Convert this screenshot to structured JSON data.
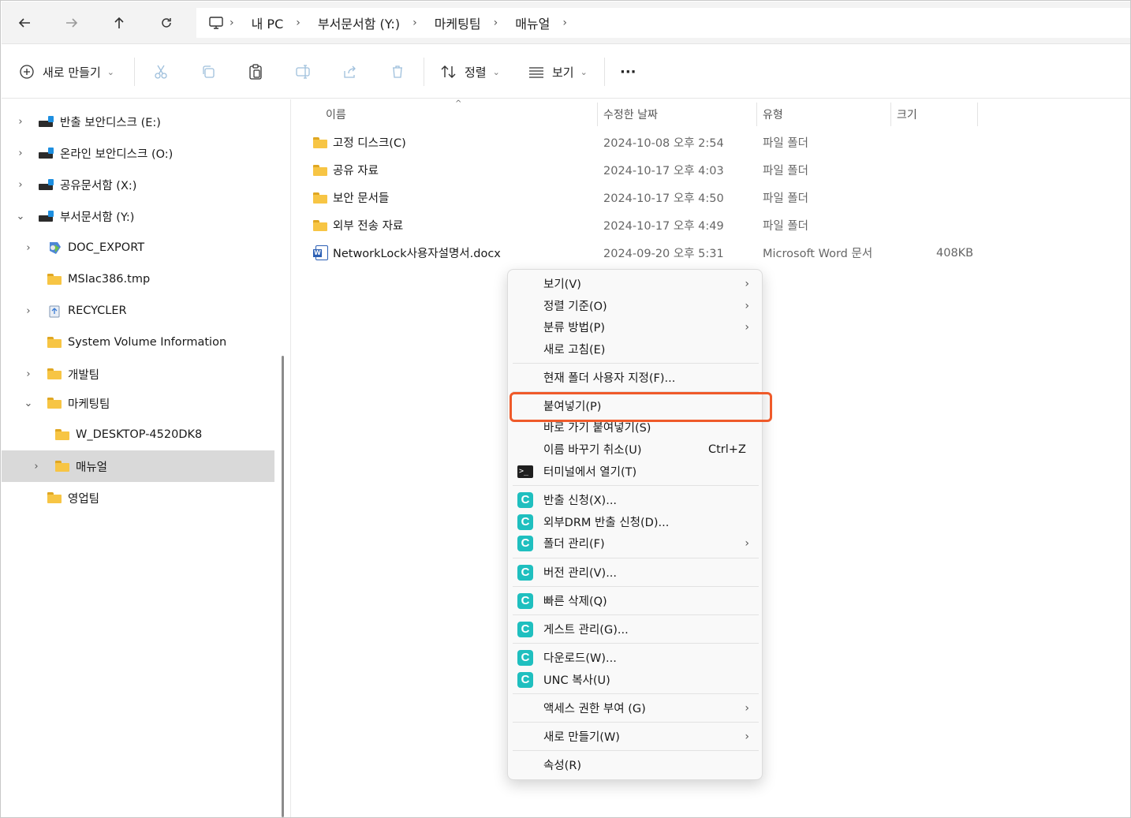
{
  "address_bar": {
    "back_icon": "arrow-left-icon",
    "forward_icon": "arrow-right-icon",
    "up_icon": "arrow-up-icon",
    "refresh_icon": "refresh-icon",
    "computer_icon": "monitor-icon",
    "breadcrumbs": [
      "내 PC",
      "부서문서함 (Y:)",
      "마케팅팀",
      "매뉴얼"
    ],
    "separator": "›"
  },
  "toolbar": {
    "new_label": "새로 만들기",
    "sort_label": "정렬",
    "view_label": "보기",
    "more_label": "···",
    "caret": "⌄"
  },
  "nav": {
    "items": [
      {
        "label": "반출 보안디스크 (E:)",
        "chevron": "›",
        "icon": "drive"
      },
      {
        "label": "온라인 보안디스크 (O:)",
        "chevron": "›",
        "icon": "drive"
      },
      {
        "label": "공유문서함 (X:)",
        "chevron": "›",
        "icon": "drive"
      },
      {
        "label": "부서문서함 (Y:)",
        "chevron": "⌄",
        "icon": "drive"
      },
      {
        "label": "DOC_EXPORT",
        "chevron": "›",
        "icon": "network-folder"
      },
      {
        "label": "MSIac386.tmp",
        "chevron": "",
        "icon": "folder"
      },
      {
        "label": "RECYCLER",
        "chevron": "›",
        "icon": "recycle"
      },
      {
        "label": "System Volume Information",
        "chevron": "",
        "icon": "folder"
      },
      {
        "label": "개발팀",
        "chevron": "›",
        "icon": "folder"
      },
      {
        "label": "마케팅팀",
        "chevron": "⌄",
        "icon": "folder"
      },
      {
        "label": "W_DESKTOP-4520DK8",
        "chevron": "",
        "icon": "folder"
      },
      {
        "label": "매뉴얼",
        "chevron": "›",
        "icon": "folder"
      },
      {
        "label": "영업팀",
        "chevron": "",
        "icon": "folder"
      }
    ]
  },
  "columns": {
    "name": "이름",
    "modified": "수정한 날짜",
    "type": "유형",
    "size": "크기"
  },
  "files": [
    {
      "name": "고정 디스크(C)",
      "modified": "2024-10-08 오후 2:54",
      "type": "파일 폴더",
      "size": ""
    },
    {
      "name": "공유 자료",
      "modified": "2024-10-17 오후 4:03",
      "type": "파일 폴더",
      "size": ""
    },
    {
      "name": "보안 문서들",
      "modified": "2024-10-17 오후 4:50",
      "type": "파일 폴더",
      "size": ""
    },
    {
      "name": "외부 전송 자료",
      "modified": "2024-10-17 오후 4:49",
      "type": "파일 폴더",
      "size": ""
    },
    {
      "name": "NetworkLock사용자설명서.docx",
      "modified": "2024-09-20 오후 5:31",
      "type": "Microsoft Word 문서",
      "size": "408KB"
    }
  ],
  "context_menu": {
    "items": [
      {
        "label": "보기(V)",
        "arrow": "›"
      },
      {
        "label": "정렬 기준(O)",
        "arrow": "›"
      },
      {
        "label": "분류 방법(P)",
        "arrow": "›"
      },
      {
        "label": "새로 고침(E)",
        "arrow": ""
      },
      {
        "label": "현재 폴더 사용자 지정(F)...",
        "arrow": ""
      },
      {
        "label": "붙여넣기(P)",
        "arrow": ""
      },
      {
        "label": "바로 가기 붙여넣기(S)",
        "arrow": ""
      },
      {
        "label": "이름 바꾸기 취소(U)",
        "shortcut": "Ctrl+Z"
      },
      {
        "label": "터미널에서 열기(T)",
        "icon": ">_"
      },
      {
        "label": "반출 신청(X)...",
        "icon": "C"
      },
      {
        "label": "외부DRM 반출 신청(D)...",
        "icon": "C"
      },
      {
        "label": "폴더 관리(F)",
        "icon": "C",
        "arrow": "›"
      },
      {
        "label": "버전 관리(V)...",
        "icon": "C"
      },
      {
        "label": "빠른 삭제(Q)",
        "icon": "C"
      },
      {
        "label": "게스트 관리(G)...",
        "icon": "C"
      },
      {
        "label": "다운로드(W)...",
        "icon": "C"
      },
      {
        "label": "UNC 복사(U)",
        "icon": "C"
      },
      {
        "label": "액세스 권한 부여 (G)",
        "arrow": "›"
      },
      {
        "label": "새로 만들기(W)",
        "arrow": "›"
      },
      {
        "label": "속성(R)",
        "arrow": ""
      }
    ],
    "highlight_color": "#ef5a2a"
  }
}
